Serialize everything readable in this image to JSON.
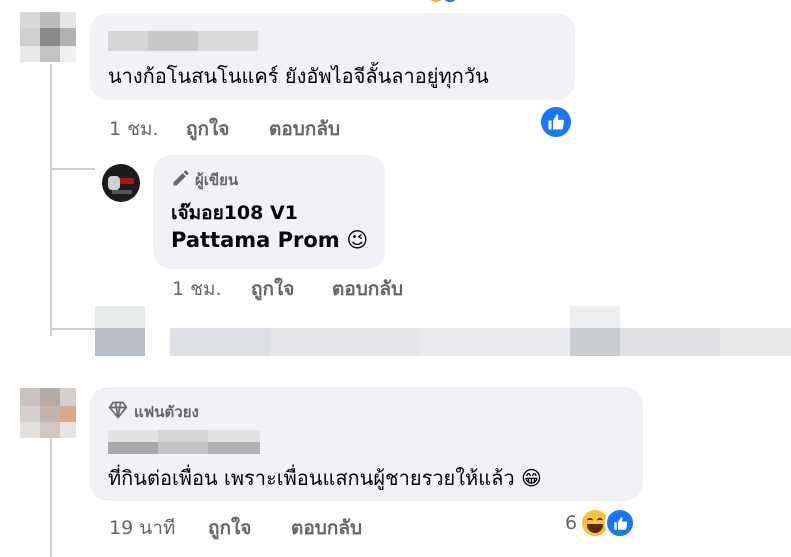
{
  "comment1": {
    "text": "นางก้อโนสนโนแคร์ ยังอัพไอจีลั้นลาอยู่ทุกวัน",
    "time": "1 ชม.",
    "like_label": "ถูกใจ",
    "reply_label": "ตอบกลับ"
  },
  "reply1": {
    "badge": "ผู้เขียน",
    "author": "เจ๊มอย108 V1",
    "text": "Pattama Prom",
    "emoji": "😉",
    "time": "1 ชม.",
    "like_label": "ถูกใจ",
    "reply_label": "ตอบกลับ"
  },
  "comment2": {
    "badge": "แฟนตัวยง",
    "text": "ที่กินต่อเพื่อน เพราะเพื่อนแสกนผู้ชายรวยให้แล้ว",
    "emoji": "😁",
    "time": "19 นาที",
    "like_label": "ถูกใจ",
    "reply_label": "ตอบกลับ",
    "reaction_count": "6"
  },
  "colors": {
    "bubble": "#f0f2f5",
    "meta": "#65676b",
    "like_blue": "#1877f2",
    "text": "#050505"
  },
  "icons": [
    "like-icon",
    "pencil-icon",
    "diamond-icon",
    "haha-emoji-icon"
  ]
}
